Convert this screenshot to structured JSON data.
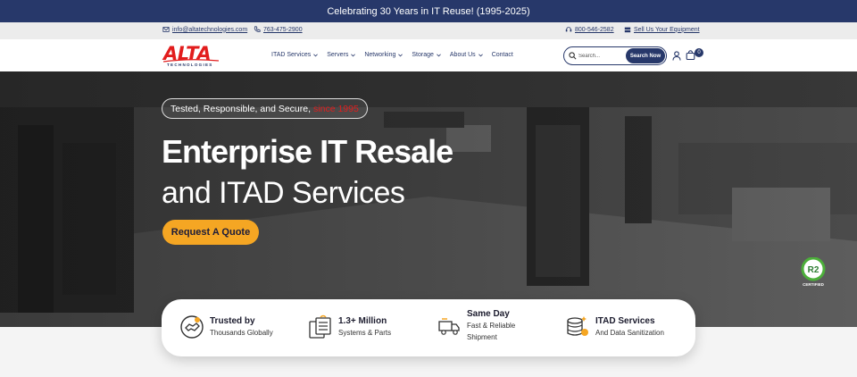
{
  "announcement": "Celebrating 30 Years in IT Reuse! (1995-2025)",
  "utility": {
    "email": "info@altatechnologies.com",
    "phone_local": "763-475-2900",
    "phone_tollfree": "800-546-2582",
    "sell_link": "Sell Us Your Equipment"
  },
  "logo": {
    "wordmark": "ALTA",
    "tagline": "TECHNOLOGIES"
  },
  "nav": {
    "items": [
      {
        "label": "ITAD Services"
      },
      {
        "label": "Servers"
      },
      {
        "label": "Networking"
      },
      {
        "label": "Storage"
      },
      {
        "label": "About Us"
      },
      {
        "label": "Contact"
      }
    ],
    "search_placeholder": "Search...",
    "search_button": "Search Now",
    "cart_count": "0"
  },
  "hero": {
    "pill_text": "Tested, Responsible, and Secure,",
    "pill_highlight": "since 1995",
    "title_line1": "Enterprise IT Resale",
    "title_line2": "and ITAD Services",
    "cta": "Request A Quote",
    "badge_top": "R2",
    "badge_bottom": "CERTIFIED"
  },
  "features": [
    {
      "icon": "handshake-icon",
      "title": "Trusted by",
      "subtitle": "Thousands Globally"
    },
    {
      "icon": "server-icon",
      "title": "1.3+ Million",
      "subtitle": "Systems & Parts"
    },
    {
      "icon": "delivery-truck-icon",
      "title": "Same Day",
      "subtitle": "Fast & Reliable",
      "subtitle2": "Shipment"
    },
    {
      "icon": "database-icon",
      "title": "ITAD Services",
      "subtitle": "And Data Sanitization"
    }
  ],
  "colors": {
    "navy": "#27386a",
    "brand_red": "#e21d1d",
    "cta_orange": "#f5a623"
  }
}
